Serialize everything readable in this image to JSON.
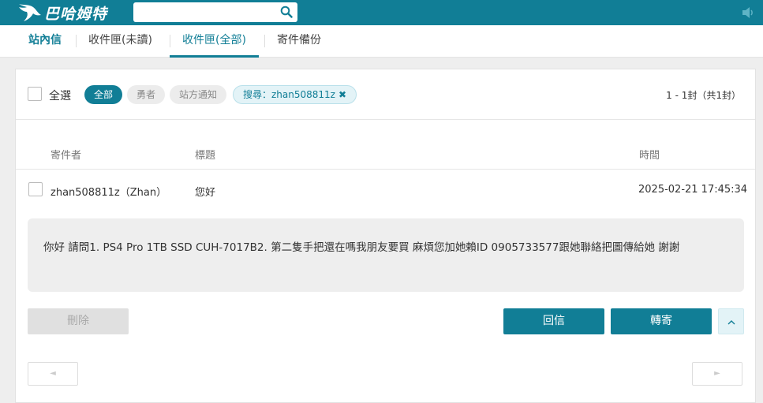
{
  "header": {
    "logo_text": "巴哈姆特",
    "search_placeholder": "",
    "colors": {
      "brand": "#117e96",
      "white": "#ffffff"
    }
  },
  "tabs": [
    {
      "label": "站內信",
      "active": false,
      "brand": true
    },
    {
      "label": "收件匣(未讀)",
      "active": false
    },
    {
      "label": "收件匣(全部)",
      "active": true
    },
    {
      "label": "寄件備份",
      "active": false
    }
  ],
  "filters": {
    "select_all_label": "全選",
    "chips": [
      {
        "label": "全部",
        "selected": true
      },
      {
        "label": "勇者",
        "selected": false
      },
      {
        "label": "站方通知",
        "selected": false
      }
    ],
    "search_chip": {
      "label": "搜尋：zhan508811z",
      "close_icon": "close-icon"
    },
    "count_text": "1 - 1封（共1封）"
  },
  "table": {
    "headers": {
      "sender": "寄件者",
      "subject": "標題",
      "time": "時間"
    },
    "rows": [
      {
        "sender": "zhan508811z（Zhan）",
        "subject": "您好",
        "time": "2025-02-21 17:45:34",
        "checked": false
      }
    ]
  },
  "message": {
    "body": "你好 請問1. PS4 Pro 1TB SSD CUH-7017B2. 第二隻手把還在嗎我朋友要買 麻煩您加她賴ID 0905733577跟她聯絡把圖傳給她 謝謝"
  },
  "actions": {
    "delete_label": "刪除",
    "reply_label": "回信",
    "forward_label": "轉寄",
    "collapse_icon": "chevron-up-icon"
  },
  "pagination": {
    "prev_icon": "◄",
    "next_icon": "►"
  }
}
